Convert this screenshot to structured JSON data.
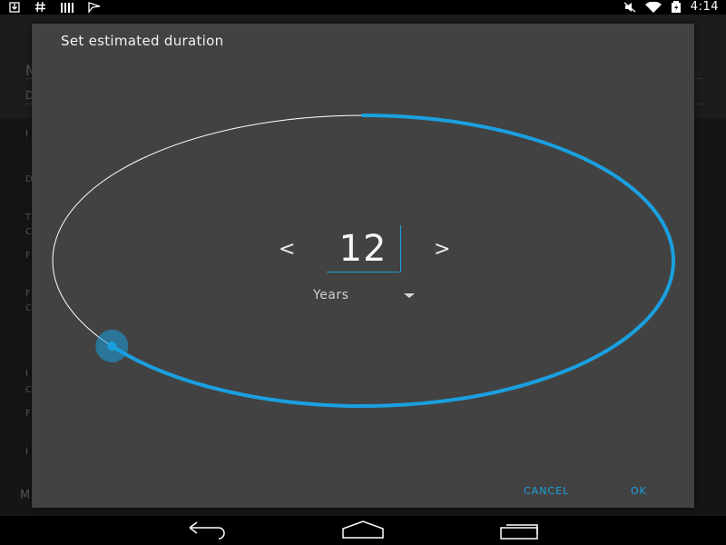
{
  "status_bar": {
    "left_icons": [
      "download-icon",
      "hash-icon",
      "signal-bars-icon",
      "flag-icon"
    ],
    "right_icons": [
      "mute-icon",
      "wifi-icon",
      "battery-icon"
    ],
    "time": "4:14"
  },
  "background_app": {
    "fragments": [
      "M",
      "D",
      "I",
      "D",
      "T",
      "C",
      "F",
      "F",
      "C",
      "I",
      "C",
      "F",
      "I",
      "M"
    ]
  },
  "dialog": {
    "title": "Set estimated duration",
    "value": "12",
    "prev_symbol": "<",
    "next_symbol": ">",
    "unit": "Years",
    "progress_fraction": 0.65,
    "cancel_label": "CANCEL",
    "ok_label": "OK"
  },
  "colors": {
    "accent": "#1aa0e0",
    "dialog_bg": "#424242",
    "track": "#ffffff"
  },
  "navigation_bar": {
    "buttons": [
      "back-icon",
      "home-icon",
      "recents-icon"
    ]
  }
}
